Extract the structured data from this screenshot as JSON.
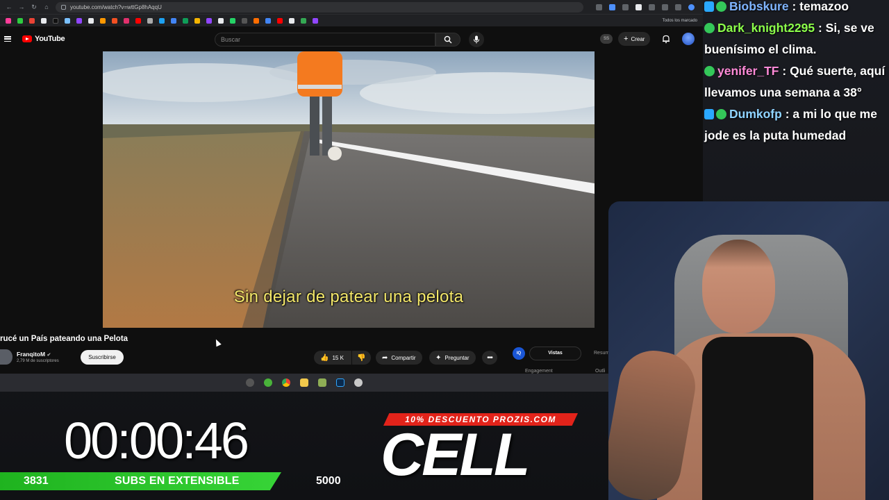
{
  "browser": {
    "url": "youtube.com/watch?v=wttGp8hAqqU",
    "bookmarks_all_label": "Todos los marcado"
  },
  "youtube": {
    "logo_text": "YouTube",
    "search_placeholder": "Buscar",
    "create_label": "Crear",
    "profile_badge": "SS"
  },
  "video": {
    "subtitle": "Sin dejar de patear una pelota",
    "title": "rucé un País pateando una Pelota",
    "channel_name": "FranqitoM",
    "channel_subscribers": "2,79 M de suscriptores",
    "subscribe_label": "Suscribirse",
    "likes": "15 K",
    "share_label": "Compartir",
    "ask_label": "Preguntar"
  },
  "extension_panel": {
    "badge": "IQ",
    "tab_active": "Vistas",
    "tab_other": "Resum",
    "label_engagement": "Engagement",
    "label_outline": "Outli"
  },
  "chat": [
    {
      "user": "Biobskure",
      "text": ": temazoo",
      "color": "#7fb4ff"
    },
    {
      "user": "Dark_knight2295",
      "text": ": Si, se ve buenísimo el clima.",
      "color": "#8cff4a"
    },
    {
      "user": "yenifer_TF",
      "text": ": Qué suerte, aquí llevamos una semana a 38°",
      "color": "#ff8ad8"
    },
    {
      "user": "Dumkofp",
      "text": ": a mi lo que me jode es la puta humedad",
      "color": "#8fd3ff"
    }
  ],
  "overlay": {
    "timer": "00:00:46",
    "subs_current": "3831",
    "subs_label": "SUBS EN EXTENSIBLE",
    "subs_goal": "5000",
    "subs_progress": 0.766,
    "promo_banner": "10% DESCUENTO PROZIS.COM",
    "promo_brand": "CELL"
  },
  "colors": {
    "youtube_red": "#ff0000",
    "progress_green": "#37d437",
    "promo_red": "#e2231a"
  }
}
